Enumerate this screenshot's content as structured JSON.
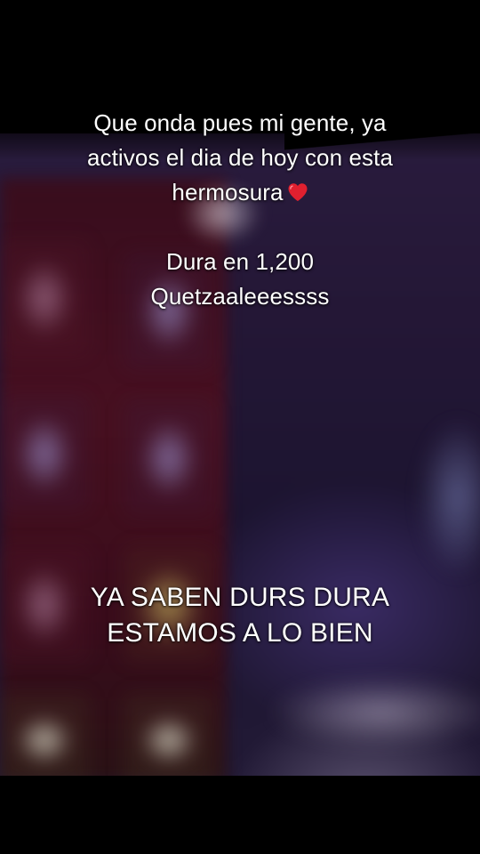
{
  "caption_top": {
    "line1": "Que onda pues mi gente, ya",
    "line2": "activos el dia de hoy con esta",
    "line3": "hermosura",
    "heart_icon": "red-heart-emoji",
    "line4": "Dura en 1,200",
    "line5": "Quetzaaleeessss"
  },
  "caption_bottom": {
    "line1": "YA SABEN DURS DURA",
    "line2": "ESTAMOS A LO BIEN"
  },
  "colors": {
    "text": "#ffffff",
    "heart": "#e0202f",
    "letterbox": "#000000"
  }
}
